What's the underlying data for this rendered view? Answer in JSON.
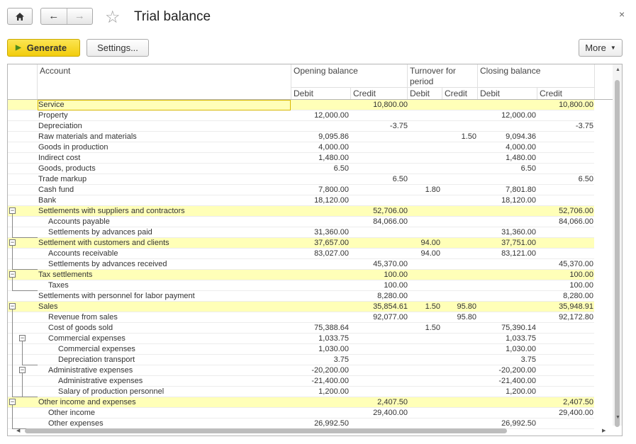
{
  "window": {
    "title": "Trial balance",
    "close_glyph": "×"
  },
  "nav": {
    "home_icon": "home-icon",
    "back_icon": "arrow-left-icon",
    "forward_icon": "arrow-right-icon",
    "favorite_icon": "star-icon"
  },
  "toolbar": {
    "generate_label": "Generate",
    "settings_label": "Settings...",
    "more_label": "More"
  },
  "colors": {
    "highlight": "#ffffb8",
    "generate_button": "#f5d31c"
  },
  "table": {
    "header": {
      "account": "Account",
      "opening_balance": "Opening balance",
      "turnover_line1": "Turnover for",
      "turnover_line2": "period",
      "closing_balance": "Closing balance",
      "debit": "Debit",
      "credit": "Credit"
    },
    "rows": [
      {
        "account": "Service",
        "level": 0,
        "hl": true,
        "sel": true,
        "ob_d": "",
        "ob_c": "10,800.00",
        "t_d": "",
        "t_c": "",
        "cb_d": "",
        "cb_c": "10,800.00"
      },
      {
        "account": "Property",
        "level": 0,
        "ob_d": "12,000.00",
        "ob_c": "",
        "t_d": "",
        "t_c": "",
        "cb_d": "12,000.00",
        "cb_c": ""
      },
      {
        "account": "Depreciation",
        "level": 0,
        "ob_d": "",
        "ob_c": "-3.75",
        "t_d": "",
        "t_c": "",
        "cb_d": "",
        "cb_c": "-3.75"
      },
      {
        "account": "Raw materials and materials",
        "level": 0,
        "ob_d": "9,095.86",
        "ob_c": "",
        "t_d": "",
        "t_c": "1.50",
        "cb_d": "9,094.36",
        "cb_c": ""
      },
      {
        "account": "Goods in production",
        "level": 0,
        "ob_d": "4,000.00",
        "ob_c": "",
        "t_d": "",
        "t_c": "",
        "cb_d": "4,000.00",
        "cb_c": ""
      },
      {
        "account": "Indirect cost",
        "level": 0,
        "ob_d": "1,480.00",
        "ob_c": "",
        "t_d": "",
        "t_c": "",
        "cb_d": "1,480.00",
        "cb_c": ""
      },
      {
        "account": "Goods, products",
        "level": 0,
        "ob_d": "6.50",
        "ob_c": "",
        "t_d": "",
        "t_c": "",
        "cb_d": "6.50",
        "cb_c": ""
      },
      {
        "account": "Trade markup",
        "level": 0,
        "ob_d": "",
        "ob_c": "6.50",
        "t_d": "",
        "t_c": "",
        "cb_d": "",
        "cb_c": "6.50"
      },
      {
        "account": "Cash fund",
        "level": 0,
        "ob_d": "7,800.00",
        "ob_c": "",
        "t_d": "1.80",
        "t_c": "",
        "cb_d": "7,801.80",
        "cb_c": ""
      },
      {
        "account": "Bank",
        "level": 0,
        "ob_d": "18,120.00",
        "ob_c": "",
        "t_d": "",
        "t_c": "",
        "cb_d": "18,120.00",
        "cb_c": ""
      },
      {
        "account": "Settlements with suppliers and contractors",
        "level": 0,
        "hl": true,
        "group": true,
        "ob_d": "",
        "ob_c": "52,706.00",
        "t_d": "",
        "t_c": "",
        "cb_d": "",
        "cb_c": "52,706.00"
      },
      {
        "account": "Accounts payable",
        "level": 1,
        "ob_d": "",
        "ob_c": "84,066.00",
        "t_d": "",
        "t_c": "",
        "cb_d": "",
        "cb_c": "84,066.00"
      },
      {
        "account": "Settlements by advances paid",
        "level": 1,
        "ob_d": "31,360.00",
        "ob_c": "",
        "t_d": "",
        "t_c": "",
        "cb_d": "31,360.00",
        "cb_c": ""
      },
      {
        "account": "Settlement with customers and clients",
        "level": 0,
        "hl": true,
        "group": true,
        "ob_d": "37,657.00",
        "ob_c": "",
        "t_d": "94.00",
        "t_c": "",
        "cb_d": "37,751.00",
        "cb_c": ""
      },
      {
        "account": "Accounts receivable",
        "level": 1,
        "ob_d": "83,027.00",
        "ob_c": "",
        "t_d": "94.00",
        "t_c": "",
        "cb_d": "83,121.00",
        "cb_c": ""
      },
      {
        "account": "Settlements by advances received",
        "level": 1,
        "ob_d": "",
        "ob_c": "45,370.00",
        "t_d": "",
        "t_c": "",
        "cb_d": "",
        "cb_c": "45,370.00"
      },
      {
        "account": "Tax settlements",
        "level": 0,
        "hl": true,
        "group": true,
        "ob_d": "",
        "ob_c": "100.00",
        "t_d": "",
        "t_c": "",
        "cb_d": "",
        "cb_c": "100.00"
      },
      {
        "account": "Taxes",
        "level": 1,
        "ob_d": "",
        "ob_c": "100.00",
        "t_d": "",
        "t_c": "",
        "cb_d": "",
        "cb_c": "100.00"
      },
      {
        "account": "Settlements with personnel for labor payment",
        "level": 0,
        "ob_d": "",
        "ob_c": "8,280.00",
        "t_d": "",
        "t_c": "",
        "cb_d": "",
        "cb_c": "8,280.00"
      },
      {
        "account": "Sales",
        "level": 0,
        "hl": true,
        "group": true,
        "ob_d": "",
        "ob_c": "35,854.61",
        "t_d": "1.50",
        "t_c": "95.80",
        "cb_d": "",
        "cb_c": "35,948.91"
      },
      {
        "account": "Revenue from sales",
        "level": 1,
        "ob_d": "",
        "ob_c": "92,077.00",
        "t_d": "",
        "t_c": "95.80",
        "cb_d": "",
        "cb_c": "92,172.80"
      },
      {
        "account": "Cost of goods sold",
        "level": 1,
        "ob_d": "75,388.64",
        "ob_c": "",
        "t_d": "1.50",
        "t_c": "",
        "cb_d": "75,390.14",
        "cb_c": ""
      },
      {
        "account": "Commercial expenses",
        "level": 1,
        "group": true,
        "ob_d": "1,033.75",
        "ob_c": "",
        "t_d": "",
        "t_c": "",
        "cb_d": "1,033.75",
        "cb_c": ""
      },
      {
        "account": "Commercial expenses",
        "level": 2,
        "ob_d": "1,030.00",
        "ob_c": "",
        "t_d": "",
        "t_c": "",
        "cb_d": "1,030.00",
        "cb_c": ""
      },
      {
        "account": "Depreciation transport",
        "level": 2,
        "ob_d": "3.75",
        "ob_c": "",
        "t_d": "",
        "t_c": "",
        "cb_d": "3.75",
        "cb_c": ""
      },
      {
        "account": "Administrative expenses",
        "level": 1,
        "group": true,
        "ob_d": "-20,200.00",
        "ob_c": "",
        "t_d": "",
        "t_c": "",
        "cb_d": "-20,200.00",
        "cb_c": ""
      },
      {
        "account": "Administrative expenses",
        "level": 2,
        "ob_d": "-21,400.00",
        "ob_c": "",
        "t_d": "",
        "t_c": "",
        "cb_d": "-21,400.00",
        "cb_c": ""
      },
      {
        "account": "Salary of production personnel",
        "level": 2,
        "ob_d": "1,200.00",
        "ob_c": "",
        "t_d": "",
        "t_c": "",
        "cb_d": "1,200.00",
        "cb_c": ""
      },
      {
        "account": "Other income and expenses",
        "level": 0,
        "hl": true,
        "group": true,
        "ob_d": "",
        "ob_c": "2,407.50",
        "t_d": "",
        "t_c": "",
        "cb_d": "",
        "cb_c": "2,407.50"
      },
      {
        "account": "Other income",
        "level": 1,
        "ob_d": "",
        "ob_c": "29,400.00",
        "t_d": "",
        "t_c": "",
        "cb_d": "",
        "cb_c": "29,400.00"
      },
      {
        "account": "Other expenses",
        "level": 1,
        "ob_d": "26,992.50",
        "ob_c": "",
        "t_d": "",
        "t_c": "",
        "cb_d": "26,992.50",
        "cb_c": ""
      }
    ]
  }
}
